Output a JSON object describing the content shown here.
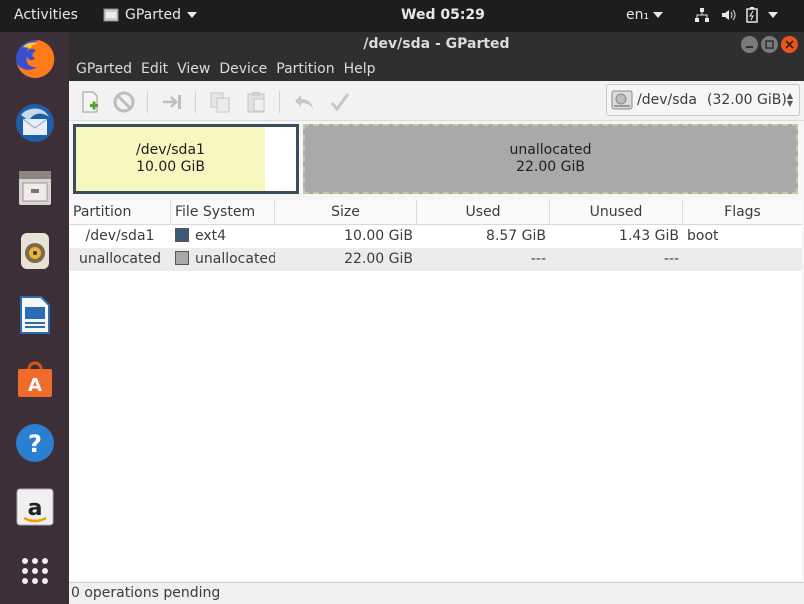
{
  "topbar": {
    "activities": "Activities",
    "app_name": "GParted",
    "clock": "Wed 05:29",
    "lang": "en₁"
  },
  "window": {
    "title": "/dev/sda - GParted"
  },
  "menu": [
    "GParted",
    "Edit",
    "View",
    "Device",
    "Partition",
    "Help"
  ],
  "device": {
    "name": "/dev/sda",
    "size": "(32.00 GiB)"
  },
  "diskmap": {
    "p1_name": "/dev/sda1",
    "p1_size": "10.00 GiB",
    "p2_name": "unallocated",
    "p2_size": "22.00 GiB",
    "p1_used_fraction": 0.857
  },
  "table": {
    "headers": [
      "Partition",
      "File System",
      "Size",
      "Used",
      "Unused",
      "Flags"
    ],
    "rows": [
      {
        "partition": "/dev/sda1",
        "fs": "ext4",
        "fs_color": "#3d5a78",
        "size": "10.00 GiB",
        "used": "8.57 GiB",
        "unused": "1.43 GiB",
        "flags": "boot"
      },
      {
        "partition": "unallocated",
        "fs": "unallocated",
        "fs_color": "#a9a9a9",
        "size": "22.00 GiB",
        "used": "---",
        "unused": "---",
        "flags": ""
      }
    ]
  },
  "status": "0 operations pending"
}
